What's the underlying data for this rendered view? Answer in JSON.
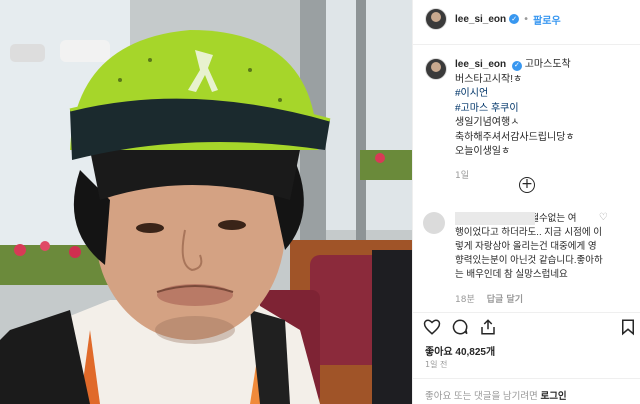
{
  "post": {
    "username": "lee_si_eon",
    "follow_label": "팔로우"
  },
  "caption": {
    "username": "lee_si_eon",
    "lines": [
      "고마스도착",
      "버스타고시작!ㅎ",
      "#이시언",
      "#고마스 후쿠이",
      "생일기념여행ㅅ",
      "축하해주셔서감사드립니당ㅎ",
      "오늘이생일ㅎ"
    ],
    "time": "1일"
  },
  "comment": {
    "text_lines": [
      "님취소할수 없는 어쩔수없는 여",
      "행이었다고 하더라도.. 지금 시점에 이",
      "렇게 자랑삼아 올리는건 대중에게 영",
      "향력있는분이 아닌것 같습니다.좋아하",
      "는 배우인데 참 실망스럽네요"
    ],
    "time": "18분",
    "reply_label": "답글 달기"
  },
  "actions": {
    "likes_label": "좋아요",
    "likes_count": "40,825개",
    "time": "1일 전"
  },
  "footer": {
    "prompt": "좋아요 또는 댓글을 남기려면",
    "login_label": "로그인"
  },
  "colors": {
    "accent": "#3897f0",
    "hashtag": "#003569",
    "cap": "#a6d62a"
  }
}
